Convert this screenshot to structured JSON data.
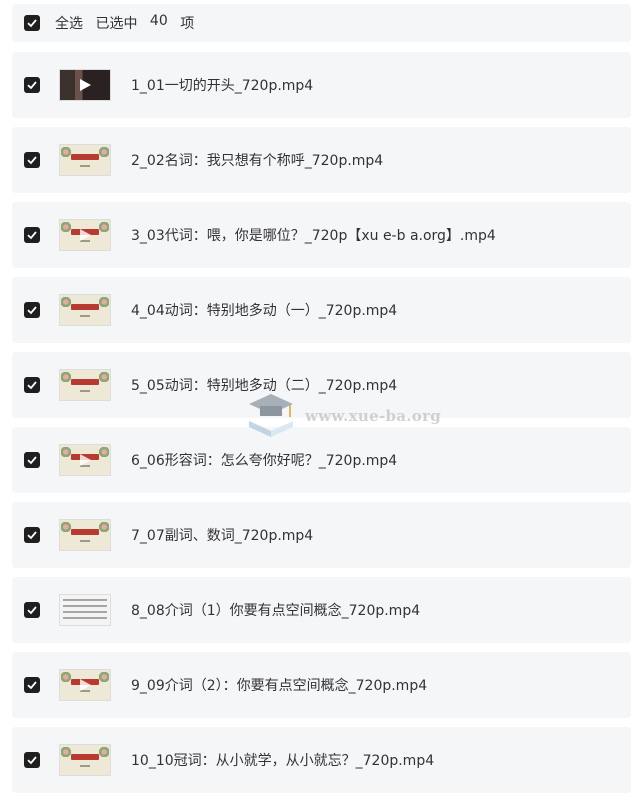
{
  "header": {
    "select_all_label": "全选",
    "selected_prefix": "已选中",
    "selected_count": "40",
    "selected_suffix": "项"
  },
  "colors": {
    "row_background": "#f5f6f8",
    "checkbox_checked": "#1f1f1f",
    "thumb_title_red": "#b73b30"
  },
  "files": [
    {
      "name": "1_01一切的开头_720p.mp4",
      "checked": true,
      "thumb": "dark-video-play"
    },
    {
      "name": "2_02名词：我只想有个称呼_720p.mp4",
      "checked": true,
      "thumb": "slide-title"
    },
    {
      "name": "3_03代词：喂，你是哪位？_720p【xu e-b a.org】.mp4",
      "checked": true,
      "thumb": "slide-title-play"
    },
    {
      "name": "4_04动词：特别地多动（一）_720p.mp4",
      "checked": true,
      "thumb": "slide-title"
    },
    {
      "name": "5_05动词：特别地多动（二）_720p.mp4",
      "checked": true,
      "thumb": "slide-title"
    },
    {
      "name": "6_06形容词：怎么夸你好呢？_720p.mp4",
      "checked": true,
      "thumb": "slide-title-play"
    },
    {
      "name": "7_07副词、数词_720p.mp4",
      "checked": true,
      "thumb": "slide-title"
    },
    {
      "name": "8_08介词（1）你要有点空间概念_720p.mp4",
      "checked": true,
      "thumb": "white-doc"
    },
    {
      "name": "9_09介词（2）：你要有点空间概念_720p.mp4",
      "checked": true,
      "thumb": "slide-title-play"
    },
    {
      "name": "10_10冠词：从小就学，从小就忘？_720p.mp4",
      "checked": true,
      "thumb": "slide-title"
    }
  ],
  "watermark": {
    "text": "www.xue-ba.org",
    "icon": "graduation-cap-book-icon"
  }
}
